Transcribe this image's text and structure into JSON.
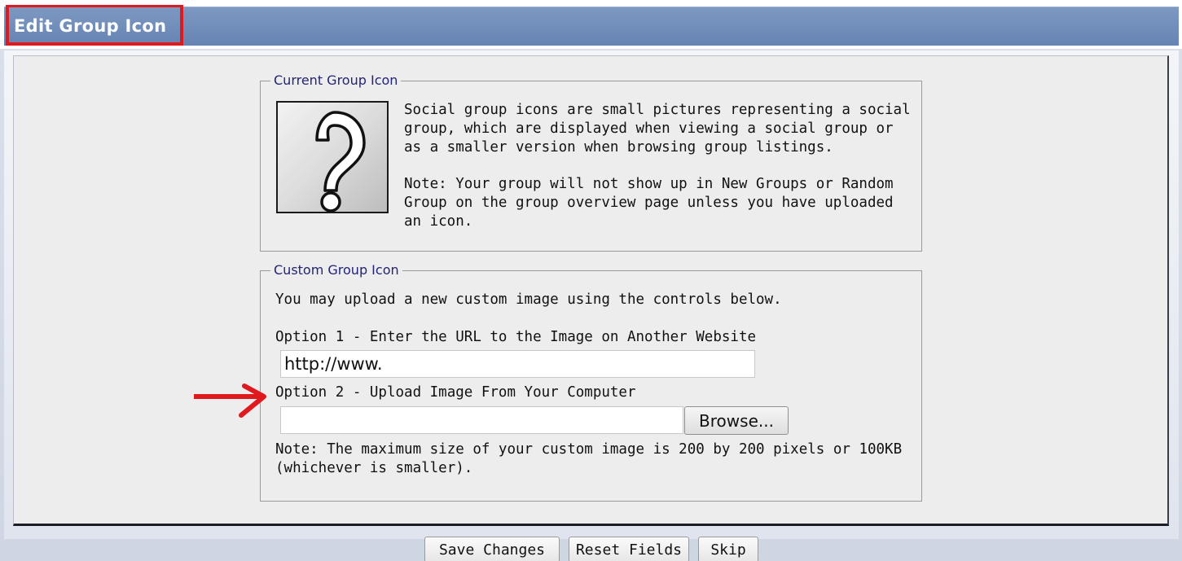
{
  "header": {
    "title": "Edit Group Icon"
  },
  "current_icon": {
    "legend": "Current Group Icon",
    "icon": "question-mark-icon",
    "description": "Social group icons are small pictures representing a social group, which are displayed when viewing a social group or as a smaller version when browsing group listings.",
    "note": "Note: Your group will not show up in New Groups or Random Group on the group overview page unless you have uploaded an icon."
  },
  "custom_icon": {
    "legend": "Custom Group Icon",
    "intro": "You may upload a new custom image using the controls below.",
    "option1_label": "Option 1 - Enter the URL to the Image on Another Website",
    "url_value": "http://www.",
    "option2_label": "Option 2 - Upload Image From Your Computer",
    "browse_label": "Browse...",
    "note": "Note: The maximum size of your custom image is 200 by 200 pixels or 100KB (whichever is smaller)."
  },
  "actions": {
    "save_label": "Save Changes",
    "reset_label": "Reset Fields",
    "skip_label": "Skip"
  },
  "colors": {
    "header_bar": "#6f8cbb",
    "highlight": "#e0191e",
    "legend_text": "#22237a"
  }
}
